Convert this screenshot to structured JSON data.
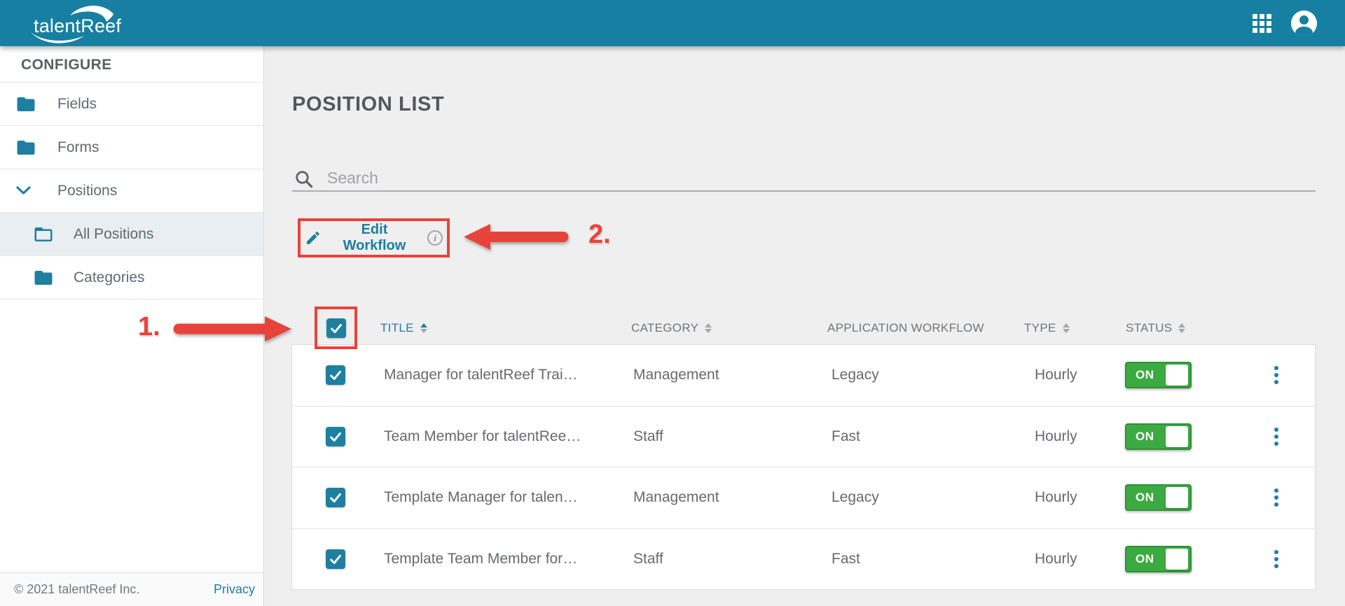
{
  "topbar": {
    "logo_text": "talentReef"
  },
  "sidebar": {
    "header": "CONFIGURE",
    "items": [
      {
        "label": "Fields",
        "icon": "folder-filled",
        "level": 0,
        "selected": false
      },
      {
        "label": "Forms",
        "icon": "folder-filled",
        "level": 0,
        "selected": false
      },
      {
        "label": "Positions",
        "icon": "chevron-down",
        "level": 0,
        "selected": false,
        "expanded": true
      },
      {
        "label": "All Positions",
        "icon": "folder-outline",
        "level": 1,
        "selected": true
      },
      {
        "label": "Categories",
        "icon": "folder-filled",
        "level": 1,
        "selected": false
      }
    ]
  },
  "footer": {
    "copyright": "© 2021 talentReef Inc.",
    "privacy_link": "Privacy"
  },
  "main": {
    "page_title": "POSITION LIST",
    "search": {
      "placeholder": "Search"
    },
    "toolbar": {
      "edit_workflow_label": "Edit Workflow",
      "info_glyph": "i"
    },
    "annotations": {
      "step_1": "1.",
      "step_2": "2."
    },
    "table": {
      "headers": {
        "title": "TITLE",
        "category": "CATEGORY",
        "workflow": "APPLICATION WORKFLOW",
        "type": "TYPE",
        "status": "STATUS"
      },
      "sorted_column": "TITLE",
      "rows": [
        {
          "selected": true,
          "title": "Manager for talentReef Trai…",
          "category": "Management",
          "workflow": "Legacy",
          "type": "Hourly",
          "status_label": "ON",
          "status_on": true
        },
        {
          "selected": true,
          "title": "Team Member for talentRee…",
          "category": "Staff",
          "workflow": "Fast",
          "type": "Hourly",
          "status_label": "ON",
          "status_on": true
        },
        {
          "selected": true,
          "title": "Template Manager for talen…",
          "category": "Management",
          "workflow": "Legacy",
          "type": "Hourly",
          "status_label": "ON",
          "status_on": true
        },
        {
          "selected": true,
          "title": "Template Team Member for…",
          "category": "Staff",
          "workflow": "Fast",
          "type": "Hourly",
          "status_label": "ON",
          "status_on": true
        }
      ]
    }
  },
  "colors": {
    "brand_teal": "#1780A2",
    "accent_teal": "#1F7FA0",
    "toggle_green": "#3BAB41",
    "annotation_red": "#E8433B",
    "main_background": "#EFEFEF"
  }
}
